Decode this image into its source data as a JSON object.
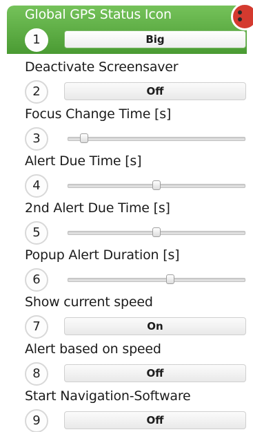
{
  "items": [
    {
      "label": "Global GPS Status Icon",
      "num": "1",
      "control": "button",
      "value": "Big"
    },
    {
      "label": "Deactivate Screensaver",
      "num": "2",
      "control": "button",
      "value": "Off"
    },
    {
      "label": "Focus Change Time [s]",
      "num": "3",
      "control": "slider",
      "level": 0.07
    },
    {
      "label": "Alert Due Time [s]",
      "num": "4",
      "control": "slider",
      "level": 0.5
    },
    {
      "label": "2nd Alert Due Time [s]",
      "num": "5",
      "control": "slider",
      "level": 0.5
    },
    {
      "label": "Popup Alert Duration [s]",
      "num": "6",
      "control": "slider",
      "level": 0.58
    },
    {
      "label": "Show current speed",
      "num": "7",
      "control": "button",
      "value": "On"
    },
    {
      "label": "Alert based on speed",
      "num": "8",
      "control": "button",
      "value": "Off"
    },
    {
      "label": "Start Navigation-Software",
      "num": "9",
      "control": "button",
      "value": "Off"
    }
  ],
  "colors": {
    "header_green": "#5aaa40",
    "badge_red": "#d43a2f"
  }
}
